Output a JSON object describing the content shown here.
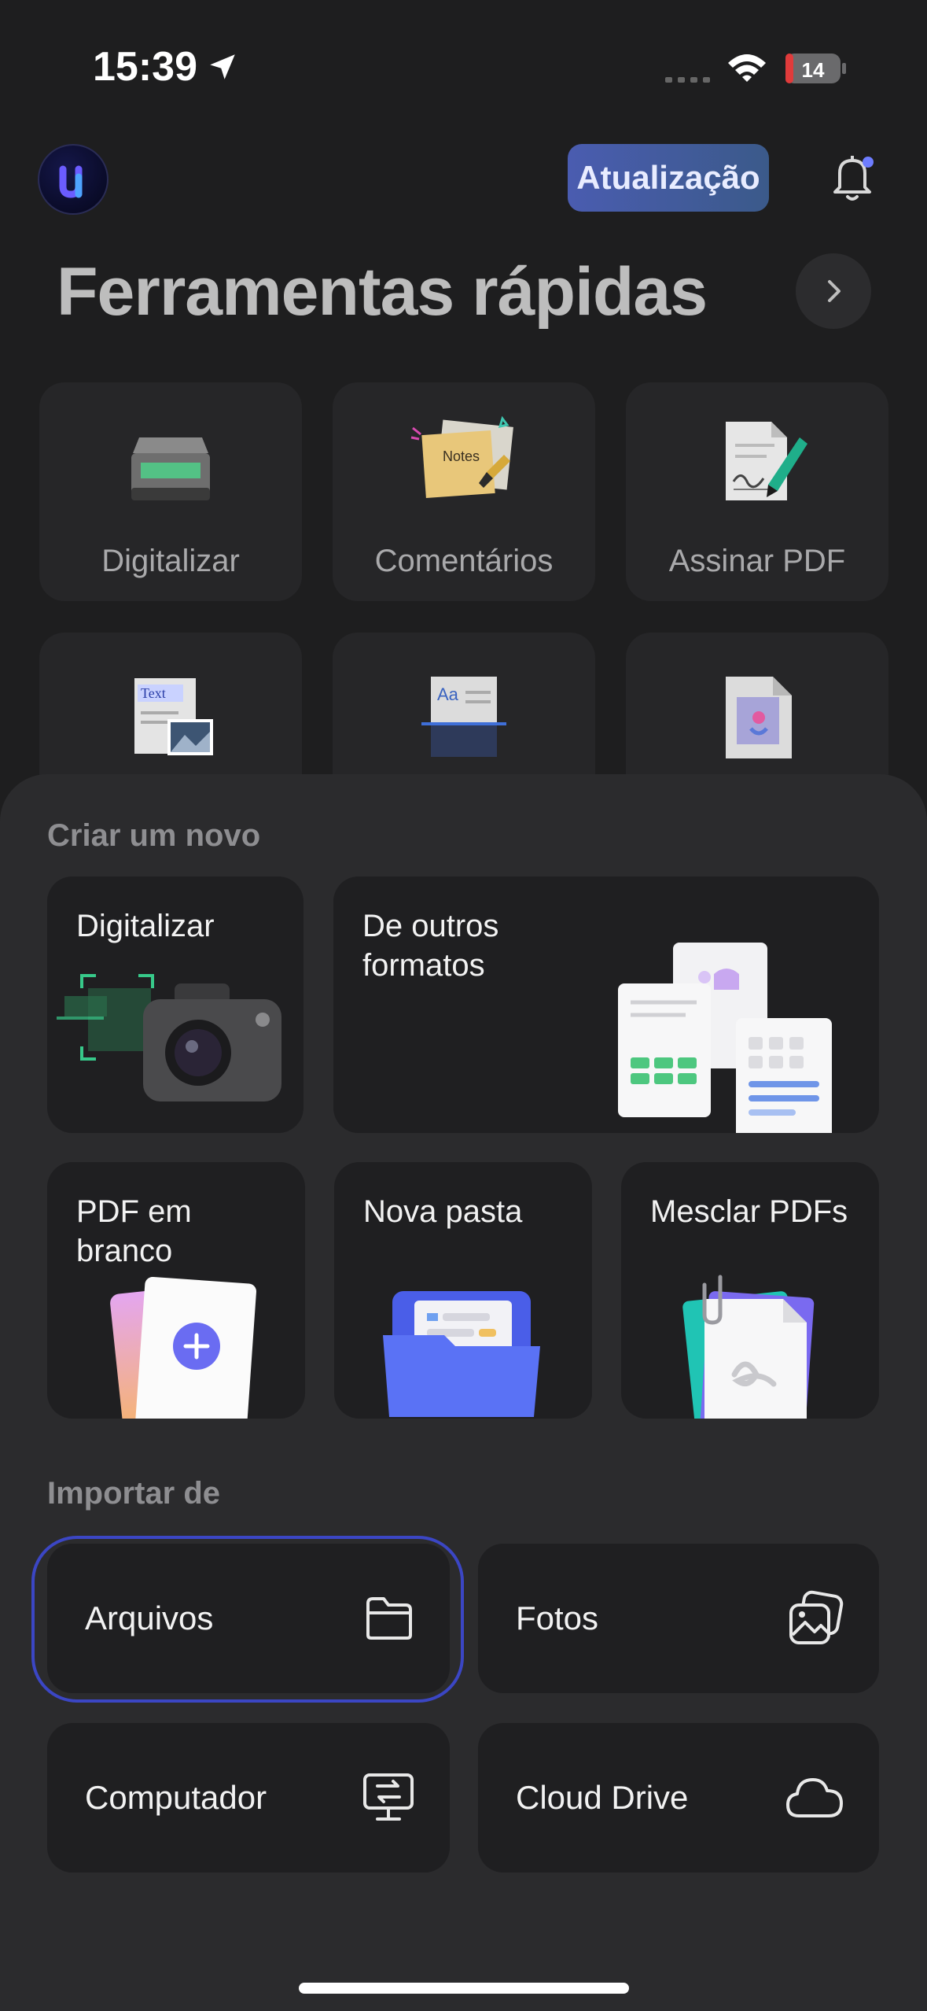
{
  "status_bar": {
    "time": "15:39",
    "battery": "14"
  },
  "header": {
    "update_label": "Atualização"
  },
  "quick_tools": {
    "title": "Ferramentas rápidas",
    "items": [
      {
        "label": "Digitalizar",
        "icon": "scanner-icon"
      },
      {
        "label": "Comentários",
        "icon": "notes-icon",
        "icon_text": "Notes"
      },
      {
        "label": "Assinar PDF",
        "icon": "signature-icon"
      },
      {
        "label": "",
        "icon": "text-image-icon",
        "icon_text": "Text"
      },
      {
        "label": "",
        "icon": "ocr-icon",
        "icon_text": "Aa"
      },
      {
        "label": "",
        "icon": "image-doc-icon"
      }
    ]
  },
  "create": {
    "title": "Criar um novo",
    "items": [
      {
        "label": "Digitalizar",
        "icon": "camera-icon"
      },
      {
        "label": "De outros formatos",
        "icon": "formats-icon"
      },
      {
        "label": "PDF em branco",
        "icon": "blank-pdf-icon"
      },
      {
        "label": "Nova pasta",
        "icon": "folder-icon"
      },
      {
        "label": "Mesclar PDFs",
        "icon": "merge-icon"
      }
    ]
  },
  "import": {
    "title": "Importar de",
    "items": [
      {
        "label": "Arquivos",
        "icon": "folder-outline-icon"
      },
      {
        "label": "Fotos",
        "icon": "photos-icon"
      },
      {
        "label": "Computador",
        "icon": "computer-transfer-icon"
      },
      {
        "label": "Cloud Drive",
        "icon": "cloud-icon"
      }
    ]
  },
  "colors": {
    "accent": "#3b46c4",
    "background": "#1e1e1f",
    "sheet": "#2b2b2d"
  }
}
